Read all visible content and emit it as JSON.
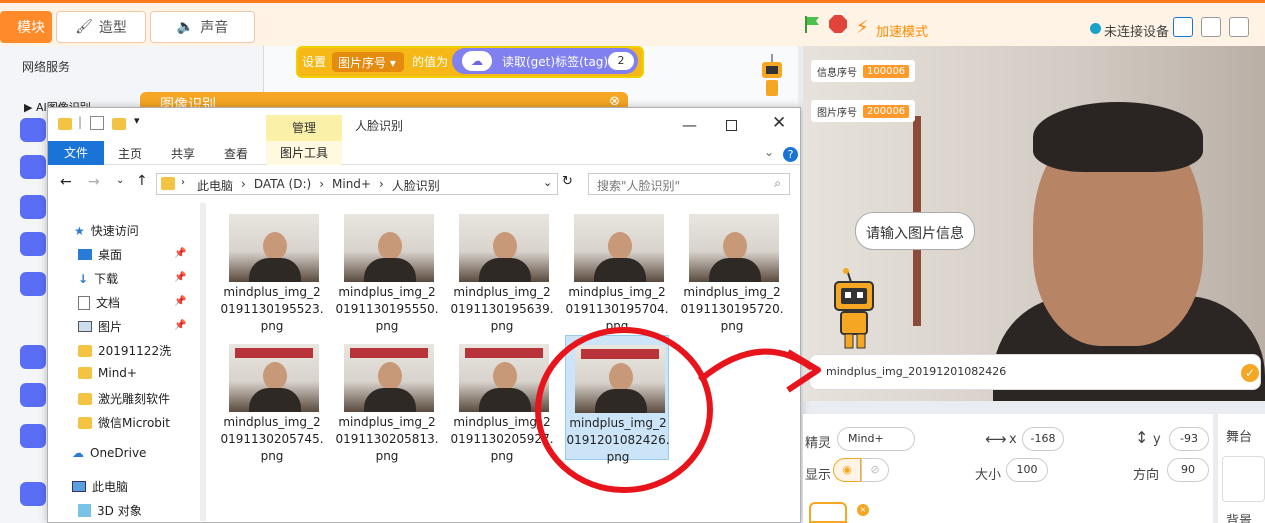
{
  "top_tabs": {
    "blocks": "模块",
    "costume": "造型",
    "sound": "声音"
  },
  "toolbar": {
    "turbo_label": "加速模式",
    "connection": "未连接设备",
    "accent": "#ff8a2a"
  },
  "palette": {
    "net_service": "网络服务",
    "ai_category": "AI图像识别"
  },
  "block": {
    "set_label": "设置",
    "var_dropdown": "图片序号",
    "value_label": "的值为",
    "read_label": "读取(get)标签(tag)",
    "read_arg": "2"
  },
  "dialog_header": "图像识别",
  "explorer": {
    "manage_tab": "管理",
    "caption": "人脸识别",
    "ribbon": {
      "file": "文件",
      "home": "主页",
      "share": "共享",
      "view": "查看",
      "picture_tools": "图片工具"
    },
    "breadcrumbs": [
      "此电脑",
      "DATA (D:)",
      "Mind+",
      "人脸识别"
    ],
    "search_placeholder": "搜索\"人脸识别\"",
    "nav": [
      {
        "label": "快速访问",
        "icon": "star-icon"
      },
      {
        "label": "桌面",
        "icon": "desktop-icon"
      },
      {
        "label": "下载",
        "icon": "download-icon"
      },
      {
        "label": "文档",
        "icon": "document-icon"
      },
      {
        "label": "图片",
        "icon": "picture-icon"
      },
      {
        "label": "20191122洗",
        "icon": "folder-icon"
      },
      {
        "label": "Mind+",
        "icon": "folder-icon"
      },
      {
        "label": "激光雕刻软件",
        "icon": "folder-icon"
      },
      {
        "label": "微信Microbit",
        "icon": "folder-icon"
      },
      {
        "label": "OneDrive",
        "icon": "cloud-icon"
      },
      {
        "label": "此电脑",
        "icon": "computer-icon"
      },
      {
        "label": "3D 对象",
        "icon": "cube-icon"
      }
    ],
    "files": [
      {
        "name": "mindplus_img_20191130195523.png"
      },
      {
        "name": "mindplus_img_20191130195550.png"
      },
      {
        "name": "mindplus_img_20191130195639.png"
      },
      {
        "name": "mindplus_img_20191130195704.png"
      },
      {
        "name": "mindplus_img_20191130195720.png"
      },
      {
        "name": "mindplus_img_20191130205745.png"
      },
      {
        "name": "mindplus_img_20191130205813.png"
      },
      {
        "name": "mindplus_img_20191130205927.png"
      },
      {
        "name": "mindplus_img_20191201082426.png",
        "selected": true
      }
    ]
  },
  "stage": {
    "vars": [
      {
        "label": "信息序号",
        "value": "100006"
      },
      {
        "label": "图片序号",
        "value": "200006"
      }
    ],
    "bubble": "请输入图片信息",
    "answer": "mindplus_img_20191201082426"
  },
  "sprite": {
    "sprite_label": "精灵",
    "sprite_name": "Mind+",
    "x_label": "x",
    "x_value": "-168",
    "y_label": "y",
    "y_value": "-93",
    "show_label": "显示",
    "size_label": "大小",
    "size_value": "100",
    "dir_label": "方向",
    "dir_value": "90",
    "stage_label": "舞台",
    "backdrop_label": "背景"
  },
  "annotation_color": "#e8141b"
}
